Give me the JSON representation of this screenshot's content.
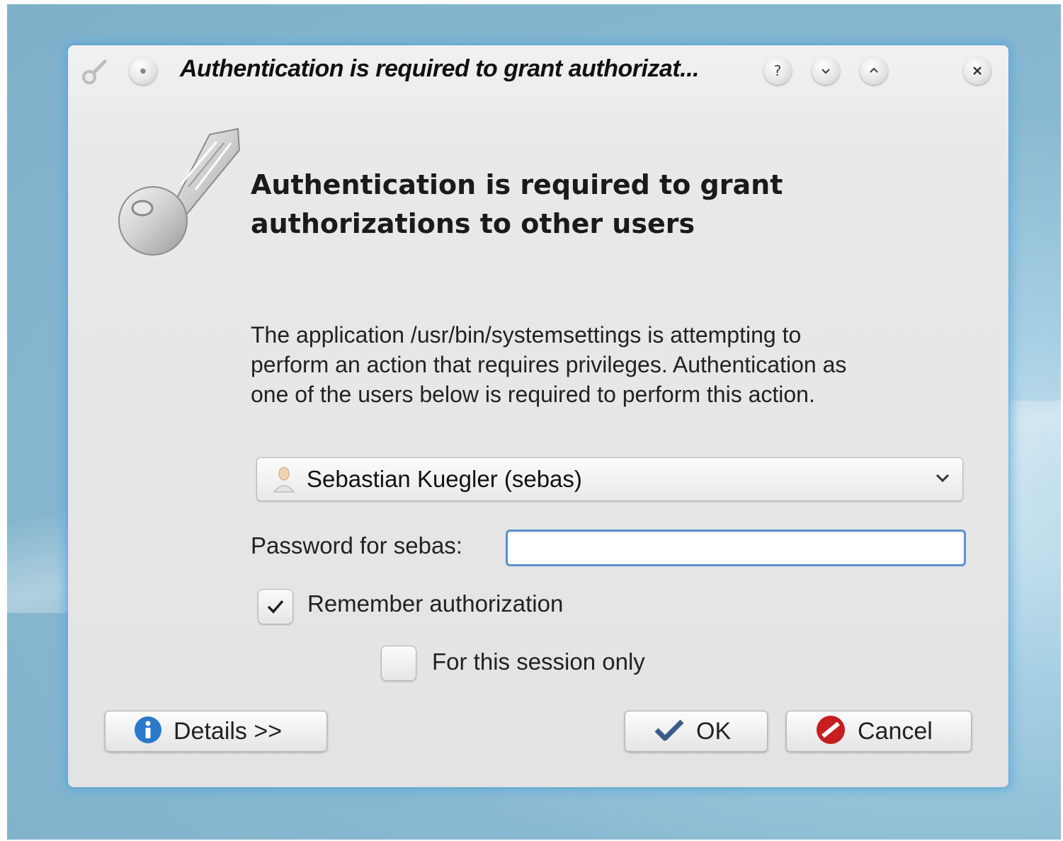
{
  "window": {
    "title": "Authentication is required to grant authorizat..."
  },
  "titlebar_buttons": {
    "help": "?",
    "minimize": "⌄",
    "maximize": "⌃",
    "close": "✕"
  },
  "dialog": {
    "heading_line1": "Authentication is required to grant",
    "heading_line2": "authorizations to other users",
    "description_line1": "The application /usr/bin/systemsettings is attempting to",
    "description_line2": "perform an action that requires privileges. Authentication as",
    "description_line3": "one of the users below is required to perform this action.",
    "user_select": {
      "selected": "Sebastian Kuegler (sebas)"
    },
    "password_label": "Password for sebas:",
    "password_value": "",
    "remember": {
      "label": "Remember authorization",
      "checked": true
    },
    "session_only": {
      "label": "For this session only",
      "checked": false
    }
  },
  "buttons": {
    "details": "Details >>",
    "ok": "OK",
    "cancel": "Cancel"
  },
  "colors": {
    "focus_border": "#5b93cf",
    "window_glow": "#5aaadc",
    "info_icon": "#2a78c8",
    "cancel_icon": "#c81e1e",
    "ok_icon": "#3b5b8a"
  }
}
